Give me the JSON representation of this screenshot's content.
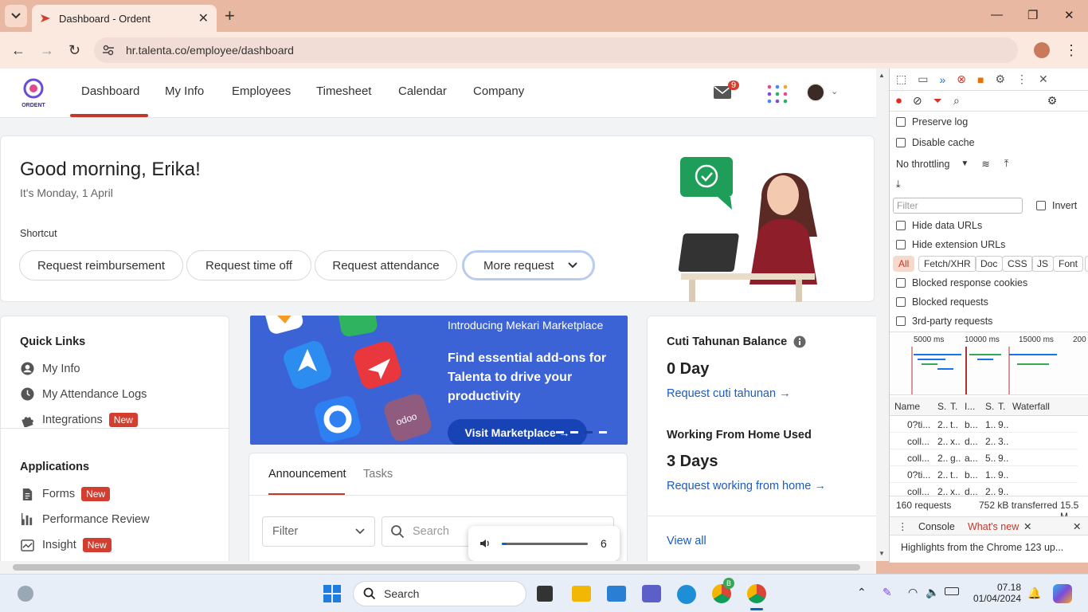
{
  "browser": {
    "tab_title": "Dashboard - Ordent",
    "url": "hr.talenta.co/employee/dashboard",
    "new_tab": "+"
  },
  "app": {
    "logo_text": "ORDENT",
    "nav": [
      "Dashboard",
      "My Info",
      "Employees",
      "Timesheet",
      "Calendar",
      "Company"
    ],
    "mail_count": "9"
  },
  "greeting": {
    "title": "Good morning, Erika!",
    "date": "It's Monday, 1 April",
    "shortcut_label": "Shortcut",
    "shortcuts": [
      "Request reimbursement",
      "Request time off",
      "Request attendance",
      "More request"
    ]
  },
  "quick_links": {
    "title": "Quick Links",
    "items": [
      {
        "label": "My Info",
        "badge": ""
      },
      {
        "label": "My Attendance Logs",
        "badge": ""
      },
      {
        "label": "Integrations",
        "badge": "New"
      }
    ]
  },
  "applications": {
    "title": "Applications",
    "items": [
      {
        "label": "Forms",
        "badge": "New"
      },
      {
        "label": "Performance Review",
        "badge": ""
      },
      {
        "label": "Insight",
        "badge": "New"
      }
    ]
  },
  "banner": {
    "kicker": "Introducing Mekari Marketplace",
    "headline": "Find essential add-ons for Talenta to drive your productivity",
    "cta": "Visit Marketplace →",
    "app_icon_label": "odoo"
  },
  "announce": {
    "tabs": [
      "Announcement",
      "Tasks"
    ],
    "filter": "Filter",
    "search_placeholder": "Search"
  },
  "balance": {
    "title": "Cuti Tahunan Balance",
    "value": "0 Day",
    "link": "Request cuti tahunan →",
    "wfh_title": "Working From Home Used",
    "wfh_value": "3 Days",
    "wfh_link": "Request working from home →",
    "view_all": "View all"
  },
  "volume": {
    "level": "6",
    "fraction": 0.06
  },
  "devtools": {
    "preserve_log": "Preserve log",
    "disable_cache": "Disable cache",
    "throttling": "No throttling",
    "filter_placeholder": "Filter",
    "invert": "Invert",
    "hide_data_urls": "Hide data URLs",
    "hide_ext_urls": "Hide extension URLs",
    "filter_types": [
      "All",
      "Fetch/XHR",
      "Doc",
      "CSS",
      "JS",
      "Font",
      "I"
    ],
    "blocked_cookies": "Blocked response cookies",
    "blocked_requests": "Blocked requests",
    "third_party": "3rd-party requests",
    "timeline_ticks": [
      "5000 ms",
      "10000 ms",
      "15000 ms",
      "200"
    ],
    "columns": [
      "Name",
      "S.",
      "T.",
      "I...",
      "S.",
      "T.",
      "Waterfall"
    ],
    "rows": [
      [
        "0?ti...",
        "2..",
        "t..",
        "b...",
        "1..",
        "9.."
      ],
      [
        "coll...",
        "2..",
        "x..",
        "d...",
        "2..",
        "3.."
      ],
      [
        "coll...",
        "2..",
        "g..",
        "a...",
        "5..",
        "9.."
      ],
      [
        "0?ti...",
        "2..",
        "t..",
        "b...",
        "1..",
        "9.."
      ],
      [
        "coll...",
        "2..",
        "x..",
        "d...",
        "2..",
        "9.."
      ]
    ],
    "summary_requests": "160 requests",
    "summary_transferred": "752 kB transferred",
    "summary_size": "15.5 M",
    "drawer_tabs": [
      "Console",
      "What's new"
    ],
    "whats_new": "Highlights from the Chrome 123 up..."
  },
  "taskbar": {
    "search": "Search",
    "time": "07.18",
    "date": "01/04/2024",
    "chrome_badge": "B"
  },
  "colors": {
    "accent_red": "#c0392b",
    "link_blue": "#1a5bc4",
    "banner_blue": "#3b63d6",
    "badge_red": "#d23f31"
  }
}
